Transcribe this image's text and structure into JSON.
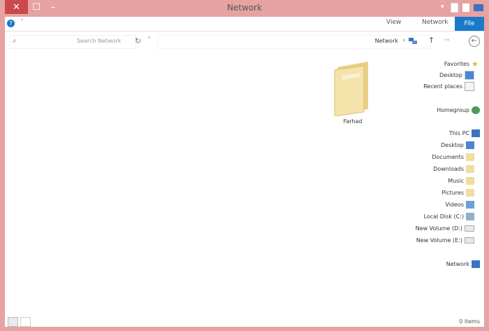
{
  "window": {
    "title": "Network",
    "close_glyph": "✕",
    "max_glyph": "☐",
    "min_glyph": "–",
    "quick_access": [
      "folder-icon",
      "properties-icon",
      "new-folder-icon",
      "customize-icon"
    ]
  },
  "ribbon": {
    "tabs": [
      "View",
      "Network"
    ],
    "file_tab": "File",
    "help_glyph": "?",
    "collapse_glyph": "˅"
  },
  "addressbar": {
    "search_placeholder": "Search Network",
    "search_glyph": "⌕",
    "refresh_glyph": "↻",
    "dropdown_glyph": "˅",
    "path": "Network",
    "sep_glyph": "›",
    "up_glyph": "↑",
    "forward_glyph": "→",
    "back_glyph": "←"
  },
  "nav": {
    "favorites": {
      "label": "Favorites",
      "items": [
        "Desktop",
        "Recent places"
      ]
    },
    "homegroup": "Homegroup",
    "thispc": {
      "label": "This PC",
      "items": [
        "Desktop",
        "Documents",
        "Downloads",
        "Music",
        "Pictures",
        "Videos",
        "Local Disk (C:)",
        "New Volume (D:)",
        "New Volume (E:)"
      ]
    },
    "network": "Network"
  },
  "content": {
    "items": [
      {
        "name": "Farhad",
        "icon": "folder-icon"
      }
    ]
  },
  "status": {
    "item_count": "0 items"
  },
  "colors": {
    "frame": "#e7a2a2",
    "accent": "#1979ca",
    "close": "#c94a4a",
    "folder": "#f2dc9e"
  }
}
